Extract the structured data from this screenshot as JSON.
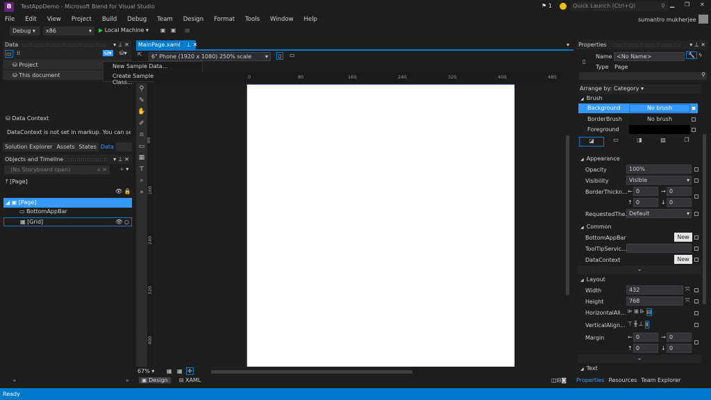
{
  "window": {
    "title": "TestAppDemo - Microsoft Blend for Visual Studio",
    "notifications": "1",
    "quick_launch_placeholder": "Quick Launch (Ctrl+Q)",
    "user": "sumantro mukherjee"
  },
  "menu": [
    "File",
    "Edit",
    "View",
    "Project",
    "Build",
    "Debug",
    "Team",
    "Design",
    "Format",
    "Tools",
    "Window",
    "Help"
  ],
  "toolbar": {
    "config": "Debug",
    "platform": "x86",
    "run_target": "Local Machine"
  },
  "data_panel": {
    "title": "Data",
    "items": [
      "Project",
      "This document"
    ],
    "dropdown": [
      "New Sample Data...",
      "Create Sample Data from Class..."
    ],
    "context_title": "Data Context",
    "context_text": "DataContext is not set in markup. You can set the"
  },
  "left_tabs": [
    "Solution Explorer",
    "Assets",
    "States",
    "Data"
  ],
  "objects_panel": {
    "title": "Objects and Timeline",
    "storyboard": "(No Storyboard open)",
    "scope": "[Page]",
    "tree": [
      {
        "label": "[Page]",
        "selected": true
      },
      {
        "label": "BottomAppBar"
      },
      {
        "label": "[Grid]"
      }
    ]
  },
  "editor": {
    "tab": "MainPage.xaml",
    "device": "6\" Phone (1920 x 1080) 250% scale",
    "ruler_h": [
      "0",
      "80",
      "160",
      "240",
      "320",
      "400",
      "480"
    ],
    "ruler_v": [
      "80",
      "160",
      "240",
      "320",
      "400"
    ],
    "zoom": "67%",
    "view_tabs": [
      "Design",
      "XAML"
    ]
  },
  "properties": {
    "title": "Properties",
    "name_label": "Name",
    "name_value": "<No Name>",
    "type_label": "Type",
    "type_value": "Page",
    "arrange": "Arrange by: Category",
    "brush": {
      "title": "Brush",
      "rows": [
        {
          "label": "Background",
          "value": "No brush"
        },
        {
          "label": "BorderBrush",
          "value": "No brush"
        },
        {
          "label": "Foreground",
          "value": ""
        }
      ]
    },
    "appearance": {
      "title": "Appearance",
      "opacity_label": "Opacity",
      "opacity": "100%",
      "visibility_label": "Visibility",
      "visibility": "Visible",
      "border_label": "BorderThickn...",
      "border": [
        "0",
        "0",
        "0",
        "0"
      ],
      "theme_label": "RequestedThe...",
      "theme": "Default"
    },
    "common": {
      "title": "Common",
      "bottomappbar": "BottomAppBar",
      "tooltip": "ToolTipServic...",
      "datacontext": "DataContext",
      "new_label": "New"
    },
    "layout": {
      "title": "Layout",
      "width_label": "Width",
      "width": "432",
      "height_label": "Height",
      "height": "768",
      "halign_label": "HorizontalAli...",
      "valign_label": "VerticalAlign...",
      "margin_label": "Margin",
      "margin": [
        "0",
        "0",
        "0",
        "0"
      ]
    },
    "text": {
      "title": "Text"
    }
  },
  "right_tabs": [
    "Properties",
    "Resources",
    "Team Explorer"
  ],
  "status": "Ready",
  "colors": {
    "accent": "#007acc",
    "selected": "#3399ff"
  }
}
